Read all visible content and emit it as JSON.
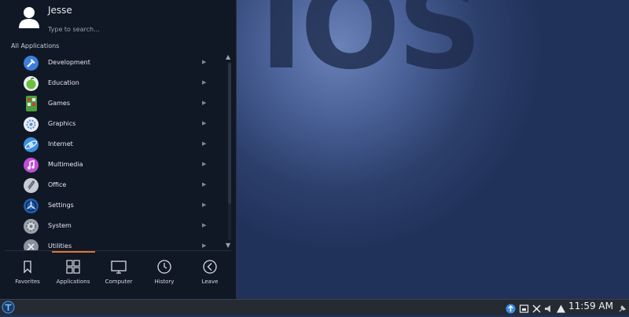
{
  "wallpaper": {
    "text": "IOS"
  },
  "launcher": {
    "user_name": "Jesse",
    "search_placeholder": "Type to search...",
    "section_title": "All Applications",
    "categories": [
      {
        "label": "Development",
        "icon": "development-icon",
        "color": "#3d7fd9"
      },
      {
        "label": "Education",
        "icon": "education-icon",
        "color": "#6bbf3a"
      },
      {
        "label": "Games",
        "icon": "games-icon",
        "color": "#4aa03a"
      },
      {
        "label": "Graphics",
        "icon": "graphics-icon",
        "color": "#e9eef5"
      },
      {
        "label": "Internet",
        "icon": "internet-icon",
        "color": "#3a8fe0"
      },
      {
        "label": "Multimedia",
        "icon": "multimedia-icon",
        "color": "#c04fd6"
      },
      {
        "label": "Office",
        "icon": "office-icon",
        "color": "#c8ccd3"
      },
      {
        "label": "Settings",
        "icon": "settings-icon",
        "color": "#1f5fae"
      },
      {
        "label": "System",
        "icon": "system-icon",
        "color": "#9aa1ab"
      },
      {
        "label": "Utilities",
        "icon": "utilities-icon",
        "color": "#8a919c"
      }
    ],
    "tabs": [
      {
        "label": "Favorites",
        "icon": "bookmark-icon"
      },
      {
        "label": "Applications",
        "icon": "grid-icon",
        "active": true
      },
      {
        "label": "Computer",
        "icon": "monitor-icon"
      },
      {
        "label": "History",
        "icon": "clock-icon"
      },
      {
        "label": "Leave",
        "icon": "chevron-left-icon"
      }
    ],
    "accent_color": "#e2752f"
  },
  "taskbar": {
    "clock": "11:59 AM",
    "tray_icons": [
      "update-icon",
      "display-icon",
      "network-icon",
      "volume-icon",
      "battery-warning-icon",
      "pin-icon"
    ]
  }
}
